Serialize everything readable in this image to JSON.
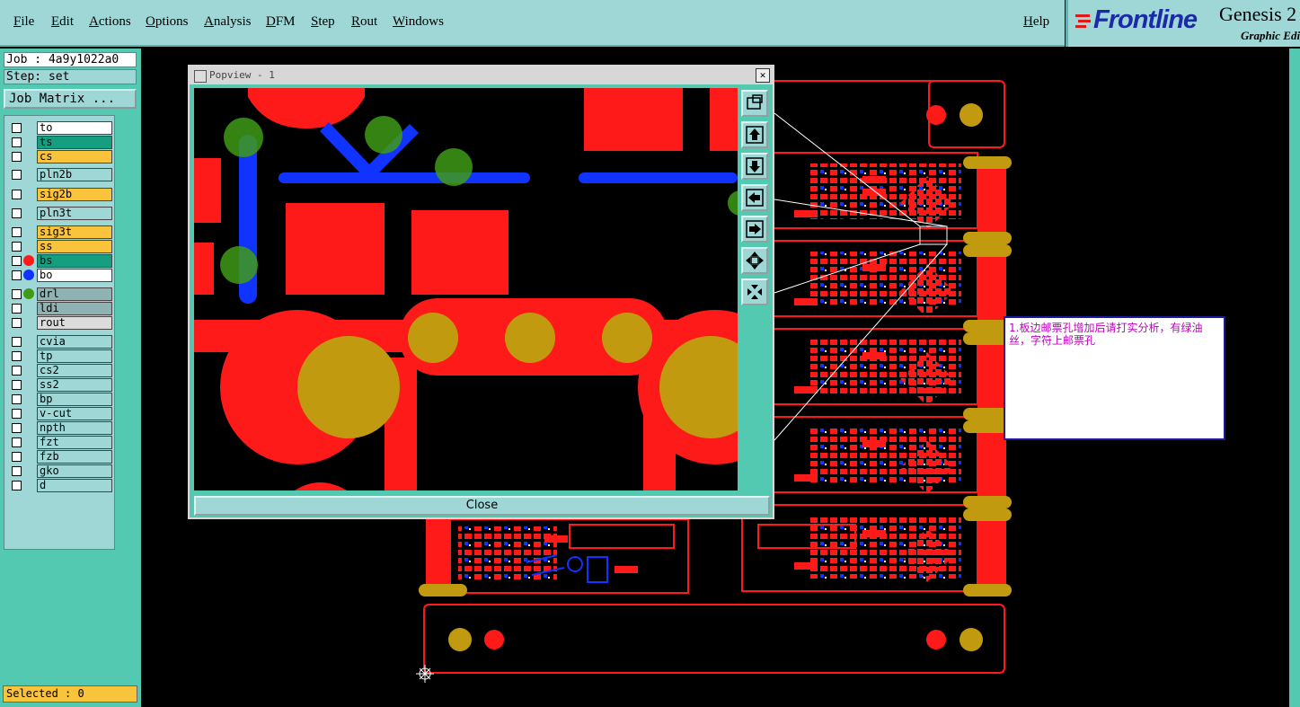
{
  "menu": [
    "File",
    "Edit",
    "Actions",
    "Options",
    "Analysis",
    "DFM",
    "Step",
    "Rout",
    "Windows"
  ],
  "help": "Help",
  "logo": {
    "name": "Frontline",
    "product": "Genesis 2",
    "subtitle": "Graphic Edi"
  },
  "job_label": "Job : 4a9y1022a0",
  "step_label": "Step: set",
  "job_matrix": "Job Matrix ...",
  "layers": [
    {
      "name": "to",
      "color": "#ffffff",
      "dot": ""
    },
    {
      "name": "ts",
      "color": "#169e80",
      "dot": ""
    },
    {
      "name": "cs",
      "color": "#f9c33c",
      "dot": ""
    },
    {
      "name": "pln2b",
      "color": "#9fd7d7",
      "dot": ""
    },
    {
      "name": "sig2b",
      "color": "#f9c33c",
      "dot": ""
    },
    {
      "name": "pln3t",
      "color": "#9fd7d7",
      "dot": ""
    },
    {
      "name": "sig3t",
      "color": "#f9c33c",
      "dot": ""
    },
    {
      "name": "ss",
      "color": "#f9c33c",
      "dot": ""
    },
    {
      "name": "bs",
      "color": "#169e80",
      "dot": "#ff1a1a"
    },
    {
      "name": "bo",
      "color": "#ffffff",
      "dot": "#1033ff"
    },
    {
      "name": "drl",
      "color": "#8fb2b2",
      "dot": "#3e9b16"
    },
    {
      "name": "ldi",
      "color": "#8fb2b2",
      "dot": ""
    },
    {
      "name": "rout",
      "color": "#dcdcdc",
      "dot": ""
    },
    {
      "name": "cvia",
      "color": "#9fd7d7",
      "dot": ""
    },
    {
      "name": "tp",
      "color": "#9fd7d7",
      "dot": ""
    },
    {
      "name": "cs2",
      "color": "#9fd7d7",
      "dot": ""
    },
    {
      "name": "ss2",
      "color": "#9fd7d7",
      "dot": ""
    },
    {
      "name": "bp",
      "color": "#9fd7d7",
      "dot": ""
    },
    {
      "name": "v-cut",
      "color": "#9fd7d7",
      "dot": ""
    },
    {
      "name": "npth",
      "color": "#9fd7d7",
      "dot": ""
    },
    {
      "name": "fzt",
      "color": "#9fd7d7",
      "dot": ""
    },
    {
      "name": "fzb",
      "color": "#9fd7d7",
      "dot": ""
    },
    {
      "name": "gko",
      "color": "#9fd7d7",
      "dot": ""
    },
    {
      "name": "d",
      "color": "#9fd7d7",
      "dot": ""
    }
  ],
  "selected": "Selected : 0",
  "popview": {
    "title": "Popview - 1",
    "close_label": "Close"
  },
  "note": "1.板边邮票孔增加后请打实分析，有绿油丝，字符上邮票孔",
  "colors": {
    "panel": "#52c9b0",
    "menubar": "#9fd7d7",
    "copper": "#ff1a1a",
    "pad": "#c29a0f",
    "trace": "#1033ff",
    "drill": "#3e9b16"
  }
}
